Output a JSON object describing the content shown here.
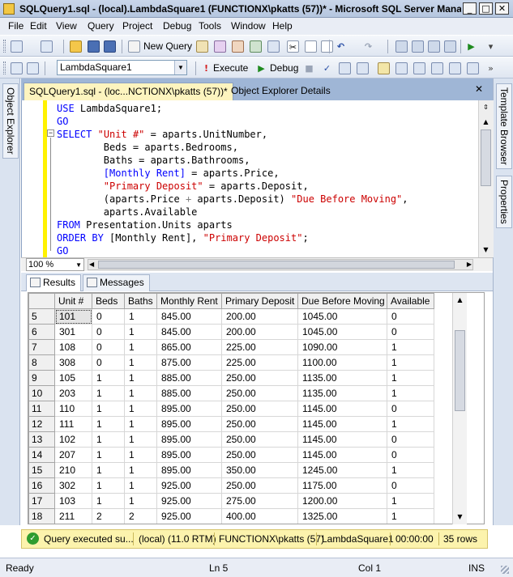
{
  "window": {
    "title": "SQLQuery1.sql - (local).LambdaSquare1 (FUNCTIONX\\pkatts (57))* - Microsoft SQL Server Mana...",
    "minimize": "_",
    "maximize": "□",
    "close": "✕"
  },
  "menu": [
    "File",
    "Edit",
    "View",
    "Query",
    "Project",
    "Debug",
    "Tools",
    "Window",
    "Help"
  ],
  "toolbar1": {
    "new_query": "New Query"
  },
  "toolbar2": {
    "database": "LambdaSquare1",
    "execute": "Execute",
    "debug": "Debug"
  },
  "side": {
    "object_explorer": "Object Explorer",
    "template_browser": "Template Browser",
    "properties": "Properties"
  },
  "tabs": {
    "query": "SQLQuery1.sql - (loc...NCTIONX\\pkatts (57))*",
    "object_explorer_details": "Object Explorer Details"
  },
  "code": {
    "l1_kw": "USE",
    "l1_rest": " LambdaSquare1;",
    "l2_kw": "GO",
    "l3_kw": "SELECT",
    "l3_str": "\"Unit #\"",
    "l3_rest": " = aparts.UnitNumber,",
    "l4": "        Beds = aparts.Bedrooms,",
    "l5": "        Baths = aparts.Bathrooms,",
    "l6_a": "        [Monthly Rent]",
    "l6_b": " = aparts.Price,",
    "l7_a": "        ",
    "l7_str": "\"Primary Deposit\"",
    "l7_b": " = aparts.Deposit,",
    "l8_a": "        (aparts.Price ",
    "l8_op": "+",
    "l8_b": " aparts.Deposit) ",
    "l8_str": "\"Due Before Moving\"",
    "l8_c": ",",
    "l9": "        aparts.Available",
    "l10_kw": "FROM",
    "l10_rest": " Presentation.Units aparts",
    "l11_kw": "ORDER BY",
    "l11_a": " [Monthly Rent], ",
    "l11_str": "\"Primary Deposit\"",
    "l11_c": ";",
    "l12_kw": "GO"
  },
  "zoom": "100 %",
  "result_tabs": {
    "results": "Results",
    "messages": "Messages"
  },
  "grid": {
    "columns": [
      "Unit #",
      "Beds",
      "Baths",
      "Monthly Rent",
      "Primary Deposit",
      "Due Before Moving",
      "Available"
    ],
    "rows": [
      {
        "n": "5",
        "cells": [
          "101",
          "0",
          "1",
          "845.00",
          "200.00",
          "1045.00",
          "0"
        ]
      },
      {
        "n": "6",
        "cells": [
          "301",
          "0",
          "1",
          "845.00",
          "200.00",
          "1045.00",
          "0"
        ]
      },
      {
        "n": "7",
        "cells": [
          "108",
          "0",
          "1",
          "865.00",
          "225.00",
          "1090.00",
          "1"
        ]
      },
      {
        "n": "8",
        "cells": [
          "308",
          "0",
          "1",
          "875.00",
          "225.00",
          "1100.00",
          "1"
        ]
      },
      {
        "n": "9",
        "cells": [
          "105",
          "1",
          "1",
          "885.00",
          "250.00",
          "1135.00",
          "1"
        ]
      },
      {
        "n": "10",
        "cells": [
          "203",
          "1",
          "1",
          "885.00",
          "250.00",
          "1135.00",
          "1"
        ]
      },
      {
        "n": "11",
        "cells": [
          "110",
          "1",
          "1",
          "895.00",
          "250.00",
          "1145.00",
          "0"
        ]
      },
      {
        "n": "12",
        "cells": [
          "111",
          "1",
          "1",
          "895.00",
          "250.00",
          "1145.00",
          "1"
        ]
      },
      {
        "n": "13",
        "cells": [
          "102",
          "1",
          "1",
          "895.00",
          "250.00",
          "1145.00",
          "0"
        ]
      },
      {
        "n": "14",
        "cells": [
          "207",
          "1",
          "1",
          "895.00",
          "250.00",
          "1145.00",
          "0"
        ]
      },
      {
        "n": "15",
        "cells": [
          "210",
          "1",
          "1",
          "895.00",
          "350.00",
          "1245.00",
          "1"
        ]
      },
      {
        "n": "16",
        "cells": [
          "302",
          "1",
          "1",
          "925.00",
          "250.00",
          "1175.00",
          "0"
        ]
      },
      {
        "n": "17",
        "cells": [
          "103",
          "1",
          "1",
          "925.00",
          "275.00",
          "1200.00",
          "1"
        ]
      },
      {
        "n": "18",
        "cells": [
          "211",
          "2",
          "2",
          "925.00",
          "400.00",
          "1325.00",
          "1"
        ]
      }
    ]
  },
  "query_status": {
    "message": "Query executed su...",
    "server": "(local) (11.0 RTM)",
    "user": "FUNCTIONX\\pkatts (57)",
    "database": "LambdaSquare1",
    "elapsed": "00:00:00",
    "rows": "35 rows"
  },
  "statusbar": {
    "state": "Ready",
    "line": "Ln 5",
    "col": "Col 1",
    "mode": "INS"
  },
  "colors": {
    "keyword": "#0000ff",
    "string": "#cc0000",
    "status_bg": "#fcf3ad",
    "active_tab": "#fdf4bf"
  }
}
